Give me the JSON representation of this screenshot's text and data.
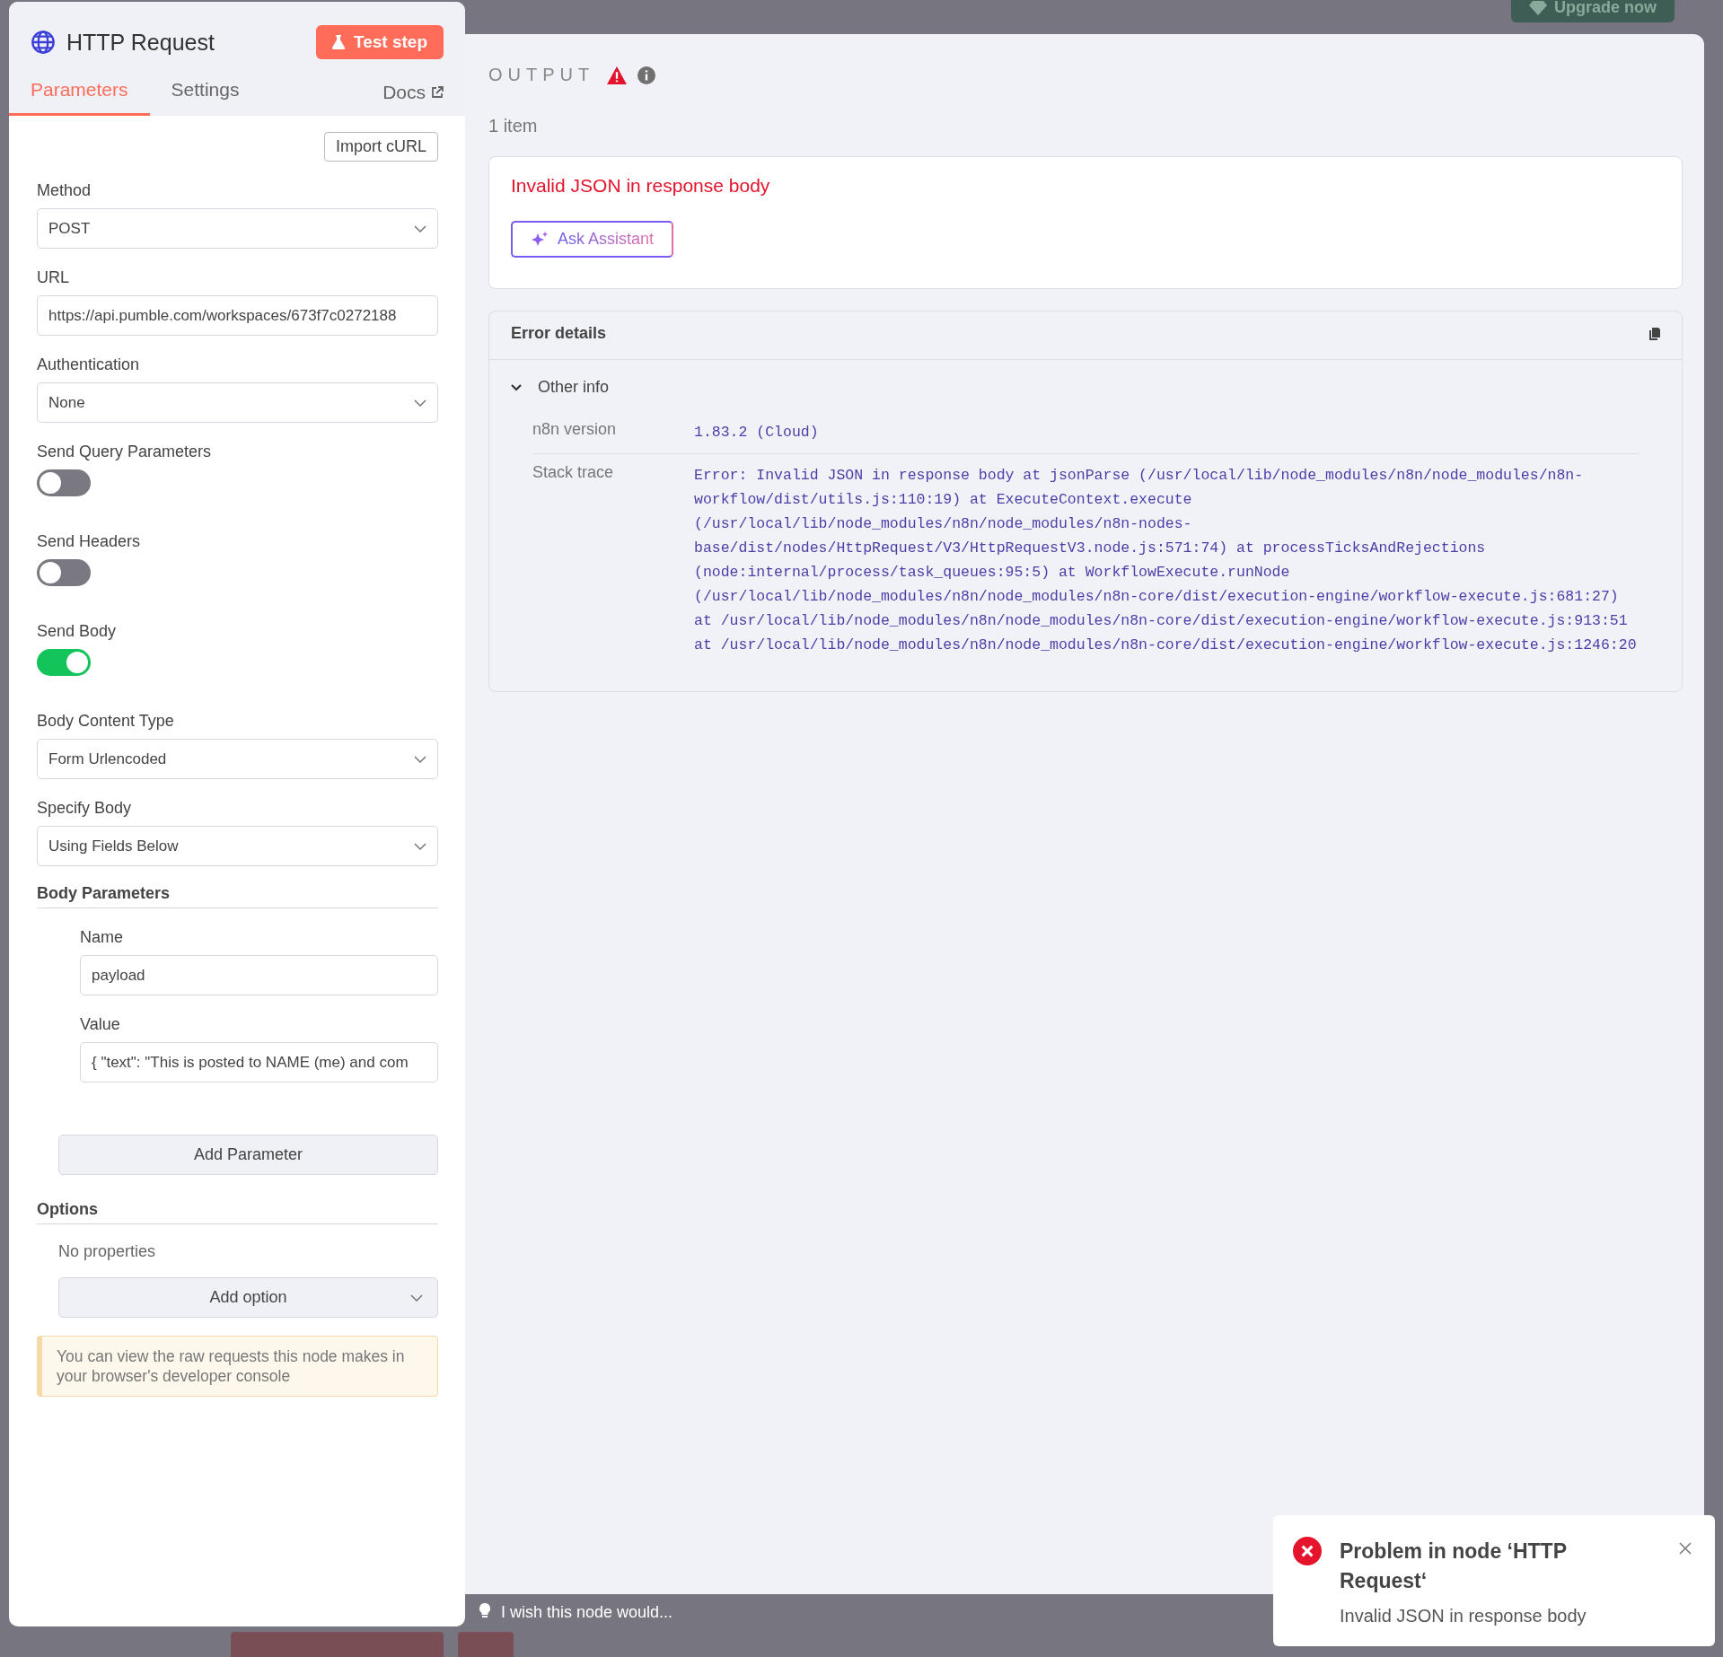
{
  "upgrade_button": "Upgrade now",
  "node_panel": {
    "title": "HTTP Request",
    "test_button": "Test step",
    "tabs": [
      {
        "label": "Parameters",
        "selected": true
      },
      {
        "label": "Settings",
        "selected": false
      }
    ],
    "docs_link": "Docs",
    "import_button": "Import cURL",
    "fields": [
      {
        "kind": "select",
        "label": "Method",
        "value": "POST"
      },
      {
        "kind": "text",
        "label": "URL",
        "value": "https://api.pumble.com/workspaces/673f7c0272188"
      },
      {
        "kind": "select",
        "label": "Authentication",
        "value": "None"
      },
      {
        "kind": "toggle",
        "label": "Send Query Parameters",
        "on": false
      },
      {
        "kind": "toggle",
        "label": "Send Headers",
        "on": false
      },
      {
        "kind": "toggle",
        "label": "Send Body",
        "on": true
      },
      {
        "kind": "select",
        "label": "Body Content Type",
        "value": "Form Urlencoded"
      },
      {
        "kind": "select",
        "label": "Specify Body",
        "value": "Using Fields Below"
      }
    ],
    "body_parameters": {
      "heading": "Body Parameters",
      "fields": [
        {
          "label": "Name",
          "value": "payload"
        },
        {
          "label": "Value",
          "value": "{ \"text\": \"This is posted to NAME (me) and com"
        }
      ],
      "add_button": "Add Parameter"
    },
    "options": {
      "heading": "Options",
      "empty_text": "No properties",
      "add_button": "Add option"
    },
    "notice": "You can view the raw requests this node makes in your browser's developer console"
  },
  "output": {
    "title": "OUTPUT",
    "item_count": "1 item",
    "error": {
      "message": "Invalid JSON in response body",
      "assistant_button": "Ask Assistant"
    },
    "error_details": {
      "title": "Error details",
      "section": {
        "label": "Other info",
        "expanded": true,
        "rows": [
          {
            "label": "n8n version",
            "value": "1.83.2 (Cloud)"
          },
          {
            "label": "Stack trace",
            "value": "Error: Invalid JSON in response body at jsonParse (/usr/local/lib/node_modules/n8n/node_modules/n8n-workflow/dist/utils.js:110:19) at ExecuteContext.execute (/usr/local/lib/node_modules/n8n/node_modules/n8n-nodes-base/dist/nodes/HttpRequest/V3/HttpRequestV3.node.js:571:74) at processTicksAndRejections (node:internal/process/task_queues:95:5) at WorkflowExecute.runNode (/usr/local/lib/node_modules/n8n/node_modules/n8n-core/dist/execution-engine/workflow-execute.js:681:27) at /usr/local/lib/node_modules/n8n/node_modules/n8n-core/dist/execution-engine/workflow-execute.js:913:51 at /usr/local/lib/node_modules/n8n/node_modules/n8n-core/dist/execution-engine/workflow-execute.js:1246:20"
          }
        ]
      }
    }
  },
  "feedback_bar": {
    "placeholder": "I wish this node would..."
  },
  "toast": {
    "title": "Problem in node ‘HTTP Request‘",
    "message": "Invalid JSON in response body"
  }
}
